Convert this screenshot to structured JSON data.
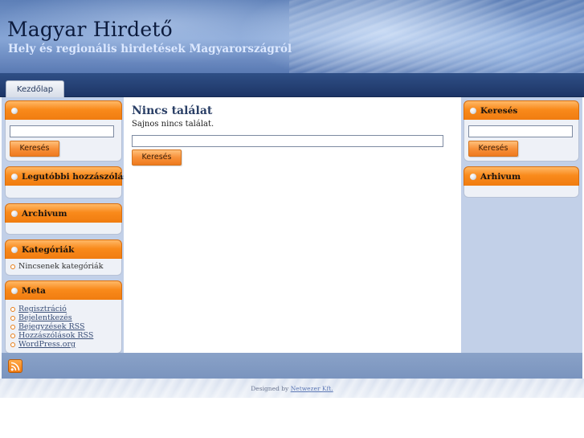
{
  "header": {
    "title": "Magyar Hirdető",
    "description": "Hely és regionális hirdetések Magyarországról"
  },
  "nav": {
    "tabs": [
      {
        "label": "Kezdőlap"
      }
    ]
  },
  "left_sidebar": {
    "search_widget": {
      "title": "",
      "button_label": "Keresés"
    },
    "recent_comments": {
      "title": "Legutóbbi hozzászólások"
    },
    "archive": {
      "title": "Archivum"
    },
    "categories": {
      "title": "Kategóriák",
      "items": [
        "Nincsenek kategóriák"
      ]
    },
    "meta": {
      "title": "Meta",
      "links": [
        "Regisztráció",
        "Bejelentkezés",
        "Bejegyzések RSS",
        "Hozzászólások RSS",
        "WordPress.org"
      ]
    }
  },
  "content": {
    "heading": "Nincs találat",
    "message": "Sajnos nincs találat.",
    "search_button_label": "Keresés"
  },
  "right_sidebar": {
    "search_widget": {
      "title": "Keresés",
      "button_label": "Keresés"
    },
    "archive": {
      "title": "Arhivum"
    }
  },
  "footer": {
    "designed_by": "Designed by",
    "designer_link": "Netwezer Kft."
  },
  "colors": {
    "accent_orange": "#f98a1b",
    "header_blue": "#5d7fb7",
    "nav_dark": "#1d3566",
    "sidebar_bg": "#c2d0e8"
  }
}
